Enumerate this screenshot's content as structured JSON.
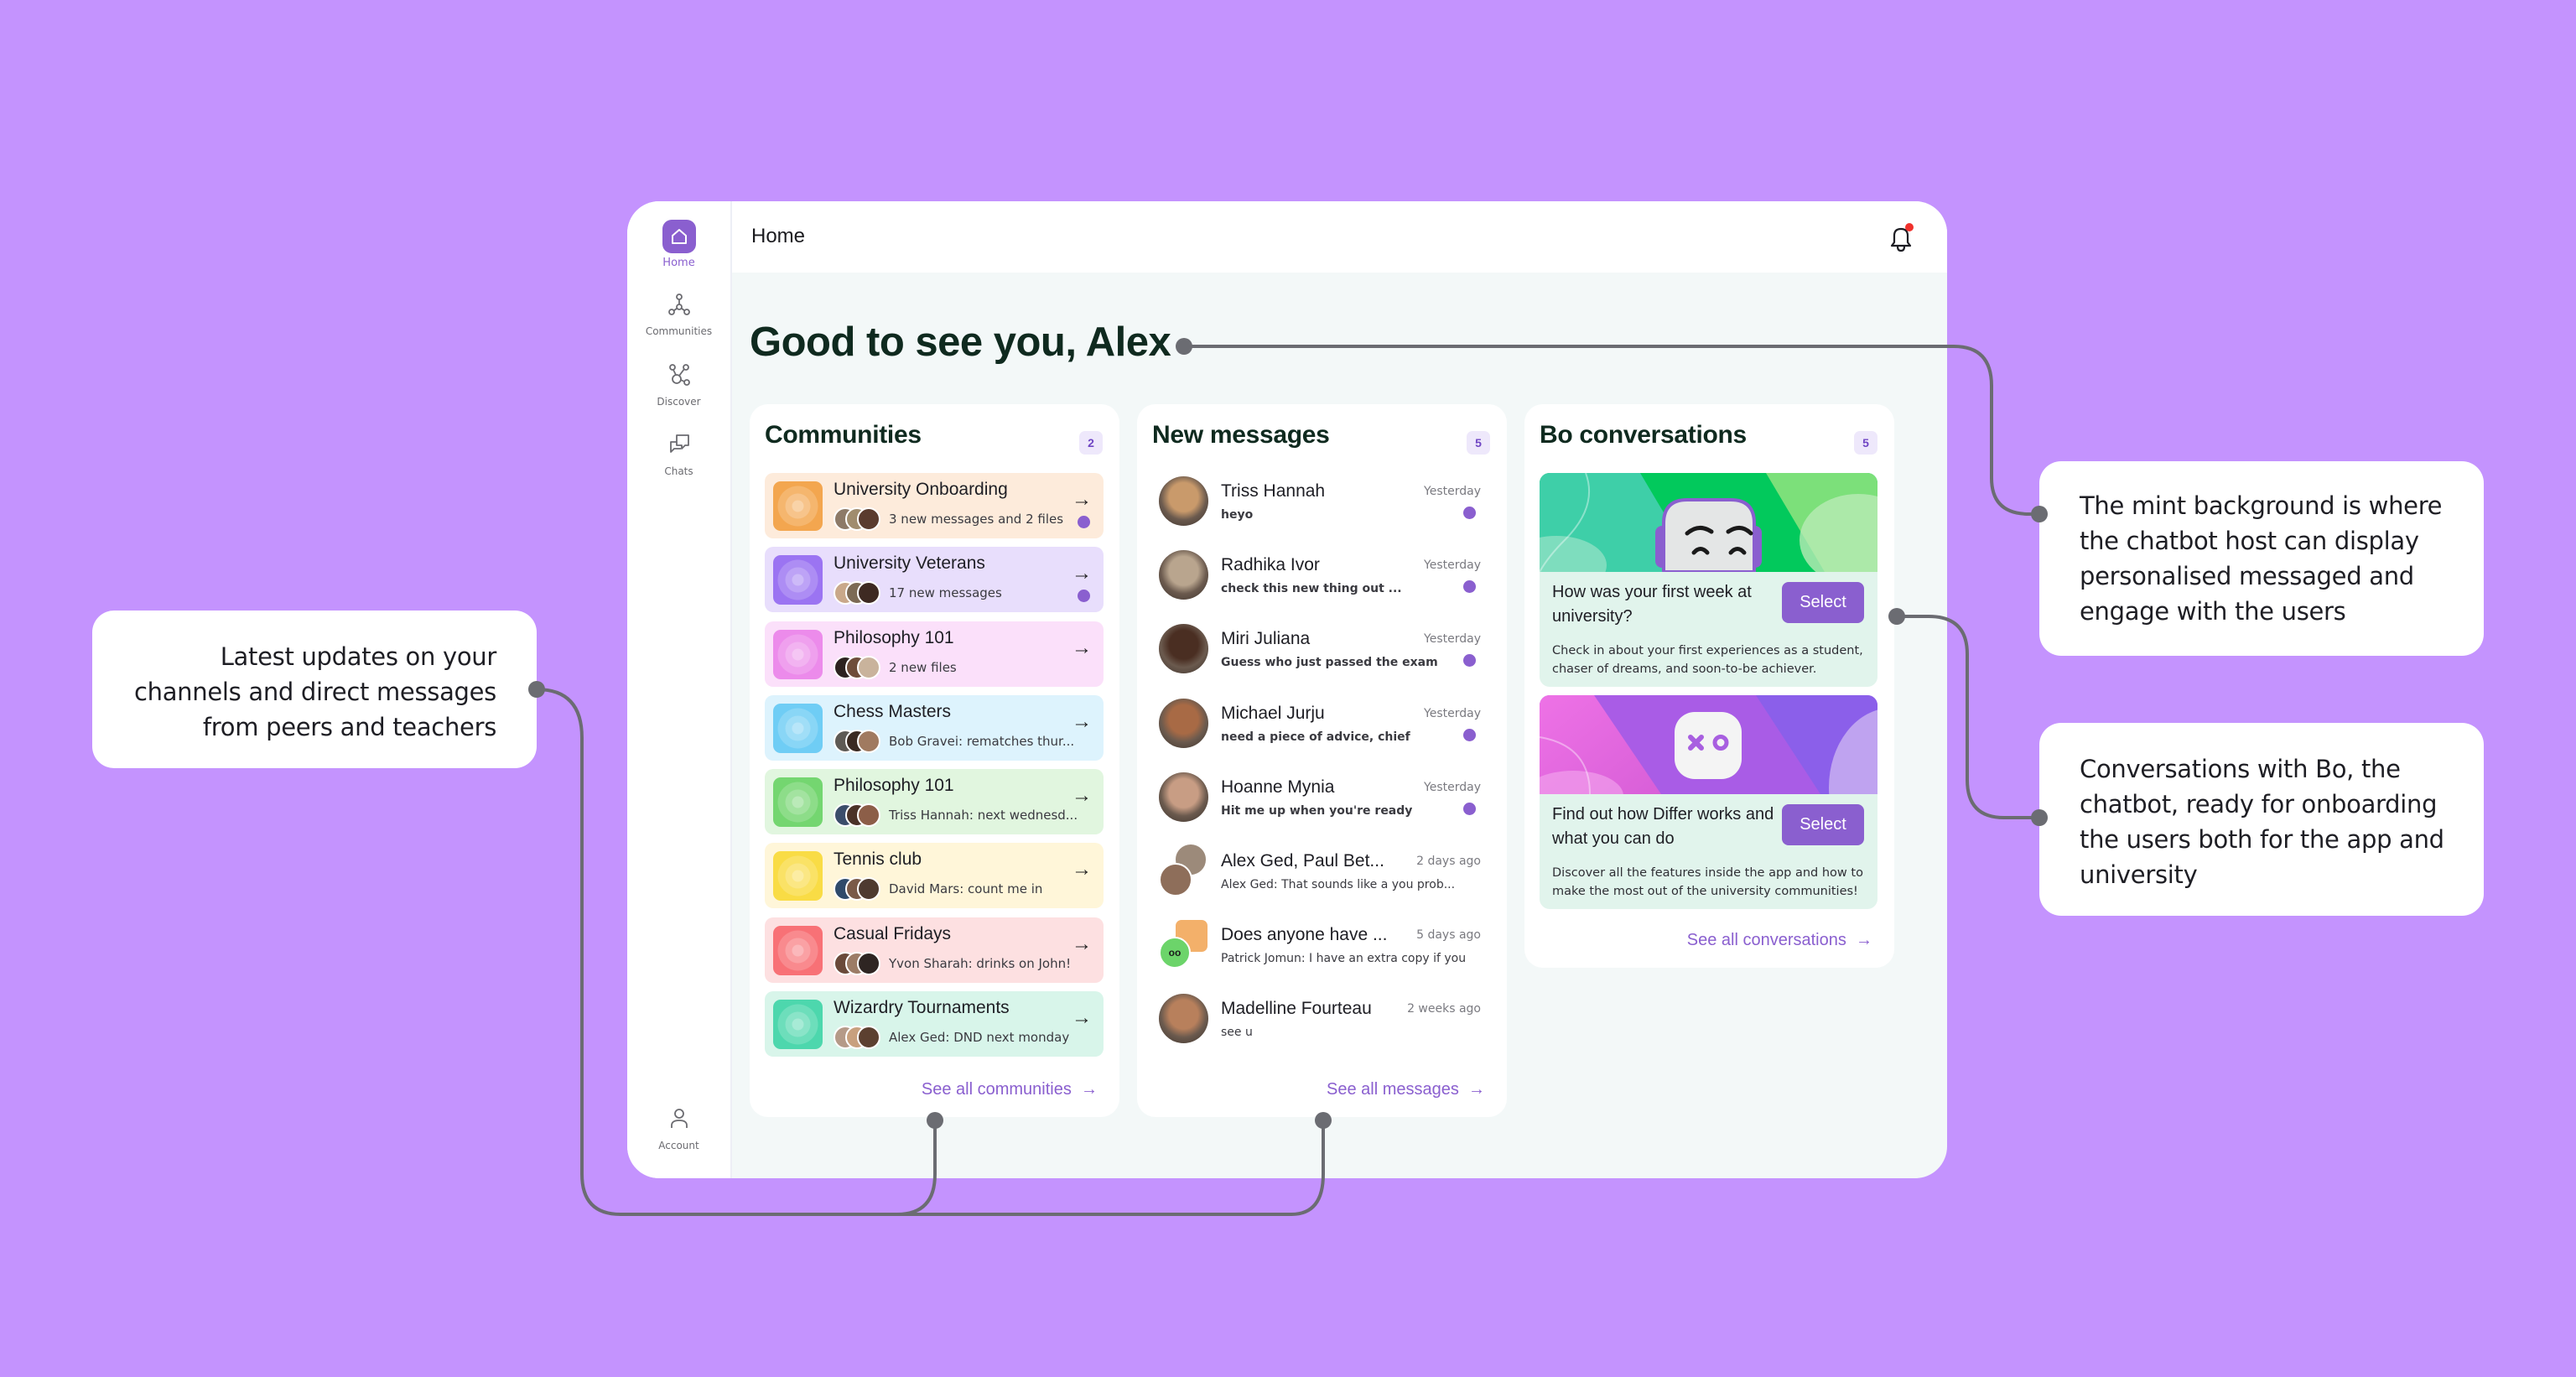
{
  "colors": {
    "background": "#C493FE",
    "accent": "#8A5FCF",
    "connector": "#6B6C72",
    "notification_dot": "#F0312C"
  },
  "callouts": {
    "left": "Latest updates on your channels and direct messages from peers and teachers",
    "right_top": "The mint background is where the chatbot host can display personalised messaged and engage with the users",
    "right_bottom": "Conversations with Bo, the chatbot, ready for onboarding the users both for the app and university"
  },
  "sidebar": {
    "items": [
      {
        "label": "Home",
        "icon": "home-icon",
        "active": true
      },
      {
        "label": "Communities",
        "icon": "communities-icon"
      },
      {
        "label": "Discover",
        "icon": "discover-icon"
      },
      {
        "label": "Chats",
        "icon": "chats-icon"
      }
    ],
    "account": {
      "label": "Account",
      "icon": "account-icon"
    }
  },
  "header": {
    "title": "Home",
    "notifications": {
      "icon": "bell-icon",
      "has_unread": true
    }
  },
  "greeting": "Good to see you, Alex",
  "communities": {
    "title": "Communities",
    "count": "2",
    "see_all": "See all communities",
    "items": [
      {
        "name": "University Onboarding",
        "subtitle": "3 new messages and 2 files",
        "unread": true,
        "bg": "#FDEBDB",
        "thumb": "#F3A64F"
      },
      {
        "name": "University Veterans",
        "subtitle": "17 new messages",
        "unread": true,
        "bg": "#E8DEFC",
        "thumb": "#9B74F2"
      },
      {
        "name": "Philosophy 101",
        "subtitle": "2 new files",
        "unread": false,
        "bg": "#FBE0FA",
        "thumb": "#EC8BEB"
      },
      {
        "name": "Chess Masters",
        "subtitle": "Bob Gravei: rematches thur...",
        "unread": false,
        "bg": "#DDF3FD",
        "thumb": "#6FCDF5"
      },
      {
        "name": "Philosophy 101",
        "subtitle": "Triss Hannah: next wednesd...",
        "unread": false,
        "bg": "#E1F6DF",
        "thumb": "#74D670"
      },
      {
        "name": "Tennis club",
        "subtitle": "David Mars: count me in",
        "unread": false,
        "bg": "#FFF6D9",
        "thumb": "#F9DC45"
      },
      {
        "name": "Casual Fridays",
        "subtitle": "Yvon Sharah: drinks on John!",
        "unread": false,
        "bg": "#FDE0E1",
        "thumb": "#F87176"
      },
      {
        "name": "Wizardry Tournaments",
        "subtitle": "Alex Ged: DND next monday",
        "unread": false,
        "bg": "#D8F5EA",
        "thumb": "#4DD7AD"
      }
    ]
  },
  "messages": {
    "title": "New messages",
    "count": "5",
    "see_all": "See all messages",
    "items": [
      {
        "name": "Triss Hannah",
        "preview": "heyo",
        "time": "Yesterday",
        "unread": true,
        "avatar": "#C99A6B"
      },
      {
        "name": "Radhika Ivor",
        "preview": "check this new thing out ...",
        "time": "Yesterday",
        "unread": true,
        "avatar": "#B9A58E"
      },
      {
        "name": "Miri Juliana",
        "preview": "Guess who just passed the exam",
        "time": "Yesterday",
        "unread": true,
        "avatar": "#4A2E22"
      },
      {
        "name": "Michael Jurju",
        "preview": "need a piece of advice, chief",
        "time": "Yesterday",
        "unread": true,
        "avatar": "#A86A45"
      },
      {
        "name": "Hoanne Mynia",
        "preview": "Hit me up when you're ready",
        "time": "Yesterday",
        "unread": true,
        "avatar": "#C89D84"
      },
      {
        "name": "Alex Ged, Paul Bet...",
        "preview": "Alex Ged: That sounds like a you prob...",
        "time": "2 days ago",
        "unread": false,
        "avatar": "#8E6E5A",
        "group": true
      },
      {
        "name": "Does anyone have ...",
        "preview": "Patrick Jomun: I have an extra copy if you",
        "time": "5 days ago",
        "unread": false,
        "avatar": "#6CD46A",
        "community": true
      },
      {
        "name": "Madelline Fourteau",
        "preview": "see u",
        "time": "2 weeks ago",
        "unread": false,
        "avatar": "#B8805C"
      }
    ]
  },
  "bo": {
    "title": "Bo conversations",
    "count": "5",
    "see_all": "See all conversations",
    "cards": [
      {
        "question": "How was your first week at university?",
        "description": "Check in about your first experiences as a student, chaser of dreams, and soon-to-be achiever.",
        "button": "Select",
        "banner": "bot-face"
      },
      {
        "question": "Find out how Differ works and what you can do",
        "description": "Discover all the features inside the app and how to make the most out of the university communities!",
        "button": "Select",
        "banner": "xo-logo"
      }
    ]
  }
}
